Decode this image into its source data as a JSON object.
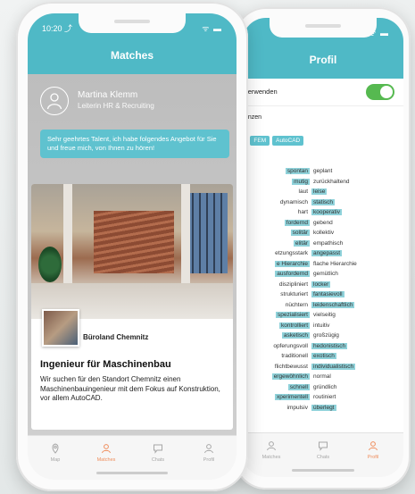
{
  "front": {
    "status": {
      "time": "10:20 ⤴",
      "signals": "ᯤ ▬"
    },
    "title": "Matches",
    "sender": {
      "name": "Martina Klemm",
      "role": "Leiterin HR & Recruiting"
    },
    "message": "Sehr geehrtes Talent, ich habe folgendes Angebot für Sie und freue mich, von Ihnen zu hören!",
    "card": {
      "company": "Büroland Chemnitz",
      "title": "Ingenieur für Maschinenbau",
      "description": "Wir suchen für den Standort Chemnitz einen Maschinenbauingenieur mit dem Fokus auf Konstruktion, vor allem AutoCAD."
    },
    "tabs": [
      {
        "label": "Map",
        "icon": "map-pin-icon",
        "active": false
      },
      {
        "label": "Matches",
        "icon": "matches-icon",
        "active": true
      },
      {
        "label": "Chats",
        "icon": "chat-icon",
        "active": false
      },
      {
        "label": "Profil",
        "icon": "profile-icon",
        "active": false
      }
    ]
  },
  "back": {
    "status": {
      "signals": "ᯤ ▬"
    },
    "title": "Profil",
    "toggle_label": "verwenden",
    "toggle_on": true,
    "section_label": "enzen",
    "chips": [
      "...",
      "FEM",
      "AutoCAD"
    ],
    "pairs": [
      {
        "left": "spontan",
        "right": "geplant",
        "highlight": "left"
      },
      {
        "left": "mutig",
        "right": "zurückhaltend",
        "highlight": "left"
      },
      {
        "left": "laut",
        "right": "leise",
        "highlight": "right"
      },
      {
        "left": "dynamisch",
        "right": "statisch",
        "highlight": "right"
      },
      {
        "left": "hart",
        "right": "kooperativ",
        "highlight": "right"
      },
      {
        "left": "fordernd",
        "right": "gebend",
        "highlight": "left"
      },
      {
        "left": "solitär",
        "right": "kollektiv",
        "highlight": "left"
      },
      {
        "left": "elitär",
        "right": "empathisch",
        "highlight": "left"
      },
      {
        "left": "etzungsstark",
        "right": "angepasst",
        "highlight": "right"
      },
      {
        "left": "e Hierarchie",
        "right": "flache Hierarchie",
        "highlight": "left"
      },
      {
        "left": "ausfordernd",
        "right": "gemütlich",
        "highlight": "left"
      },
      {
        "left": "diszipliniert",
        "right": "locker",
        "highlight": "right"
      },
      {
        "left": "strukturiert",
        "right": "fantasievoll",
        "highlight": "right"
      },
      {
        "left": "nüchtern",
        "right": "leidenschaftlich",
        "highlight": "right"
      },
      {
        "left": "spezialisiert",
        "right": "vielseitig",
        "highlight": "left"
      },
      {
        "left": "kontrolliert",
        "right": "intuitiv",
        "highlight": "left"
      },
      {
        "left": "asketisch",
        "right": "großzügig",
        "highlight": "left"
      },
      {
        "left": "opferungsvoll",
        "right": "hedonistisch",
        "highlight": "right"
      },
      {
        "left": "traditionell",
        "right": "exotisch",
        "highlight": "right"
      },
      {
        "left": "flichtbewusst",
        "right": "individualistisch",
        "highlight": "right"
      },
      {
        "left": "ergewöhnlich",
        "right": "normal",
        "highlight": "left"
      },
      {
        "left": "schnell",
        "right": "gründlich",
        "highlight": "left"
      },
      {
        "left": "xperimentell",
        "right": "routiniert",
        "highlight": "left"
      },
      {
        "left": "impulsiv",
        "right": "überlegt",
        "highlight": "right"
      }
    ],
    "tabs": [
      {
        "label": "Matches",
        "icon": "matches-icon",
        "active": false
      },
      {
        "label": "Chats",
        "icon": "chat-icon",
        "active": false
      },
      {
        "label": "Profil",
        "icon": "profile-icon",
        "active": true
      }
    ]
  },
  "colors": {
    "accent": "#4fb9c6",
    "active_tab": "#ef8d5c",
    "toggle": "#56b950",
    "highlight": "#8fd2da"
  }
}
